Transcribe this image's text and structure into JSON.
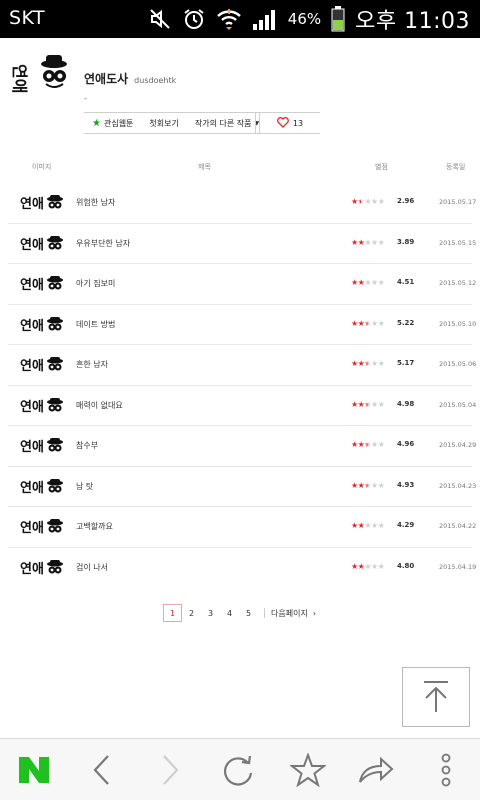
{
  "status_bar": {
    "carrier": "SKT",
    "battery": "46%",
    "time": "오후 11:03",
    "icons": [
      "mute-icon",
      "alarm-icon",
      "wifi-icon",
      "signal-icon",
      "battery-icon"
    ]
  },
  "header": {
    "title": "연애도사",
    "author": "dusdoehtk",
    "description": "-",
    "buttons": {
      "interest": "관심웹툰",
      "first_episode": "첫회보기",
      "other_works": "작가의 다른 작품"
    },
    "likes": "13"
  },
  "table": {
    "headers": {
      "image": "이미지",
      "title": "제목",
      "rating": "별점",
      "date": "등록일"
    },
    "rows": [
      {
        "title": "위험한 남자",
        "stars": 1.5,
        "rating": "2.96",
        "date": "2015.05.17"
      },
      {
        "title": "우유부단한 남자",
        "stars": 2,
        "rating": "3.89",
        "date": "2015.05.15"
      },
      {
        "title": "아기 짐보미",
        "stars": 2,
        "rating": "4.51",
        "date": "2015.05.12"
      },
      {
        "title": "데이트 방법",
        "stars": 2.5,
        "rating": "5.22",
        "date": "2015.05.10"
      },
      {
        "title": "흔한 남자",
        "stars": 2.5,
        "rating": "5.17",
        "date": "2015.05.06"
      },
      {
        "title": "매력이 없대요",
        "stars": 2.5,
        "rating": "4.98",
        "date": "2015.05.04"
      },
      {
        "title": "참수부",
        "stars": 2.5,
        "rating": "4.96",
        "date": "2015.04.29"
      },
      {
        "title": "남 탓",
        "stars": 2.5,
        "rating": "4.93",
        "date": "2015.04.23"
      },
      {
        "title": "고백할까요",
        "stars": 2,
        "rating": "4.29",
        "date": "2015.04.22"
      },
      {
        "title": "겁이 나서",
        "stars": 2,
        "rating": "4.80",
        "date": "2015.04.19"
      }
    ]
  },
  "pagination": {
    "pages": [
      "1",
      "2",
      "3",
      "4",
      "5"
    ],
    "current": "1",
    "next_label": "다음페이지"
  },
  "colors": {
    "star_on": "#e0282a",
    "star_off": "#cfcfcf",
    "naver_green": "#20c020",
    "interest_star": "#1ca01c"
  },
  "bottom_bar": {
    "items": [
      "naver-home-icon",
      "back-icon",
      "forward-icon",
      "refresh-icon",
      "bookmark-star-icon",
      "share-icon",
      "more-icon"
    ]
  }
}
